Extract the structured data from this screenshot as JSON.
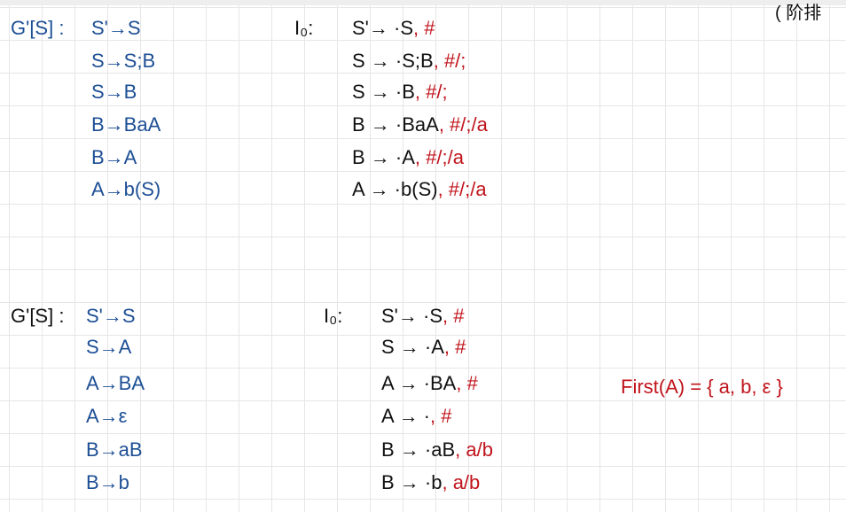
{
  "corner_text": "( 阶排",
  "grammar1": {
    "label": "G'[S] :",
    "productions": [
      "S'→S",
      "S→S;B",
      "S→B",
      "B→BaA",
      "B→A",
      "A→b(S)"
    ],
    "state_label": "I₀:",
    "items": [
      {
        "core": "S'→ ·S",
        "lookahead": ", #"
      },
      {
        "core": "S → ·S;B",
        "lookahead": ", #/;"
      },
      {
        "core": "S → ·B",
        "lookahead": ", #/;"
      },
      {
        "core": "B → ·BaA",
        "lookahead": ", #/;/a"
      },
      {
        "core": "B → ·A",
        "lookahead": ", #/;/a"
      },
      {
        "core": "A → ·b(S)",
        "lookahead": ", #/;/a"
      }
    ]
  },
  "grammar2": {
    "label": "G'[S] :",
    "productions": [
      "S'→S",
      "S→A",
      "A→BA",
      "A→ε",
      "B→aB",
      "B→b"
    ],
    "state_label": "I₀:",
    "items": [
      {
        "core": "S'→ ·S",
        "lookahead": ", #"
      },
      {
        "core": "S → ·A",
        "lookahead": ", #"
      },
      {
        "core": "A → ·BA",
        "lookahead": ", #"
      },
      {
        "core": "A → ·",
        "lookahead": ", #"
      },
      {
        "core": "B → ·aB",
        "lookahead": ", a/b"
      },
      {
        "core": "B → ·b",
        "lookahead": ", a/b"
      }
    ],
    "first_note": "First(A) = { a, b, ε }"
  },
  "colors": {
    "grammar": "#1d4f95",
    "items": "#111111",
    "lookahead": "#c0141c"
  }
}
